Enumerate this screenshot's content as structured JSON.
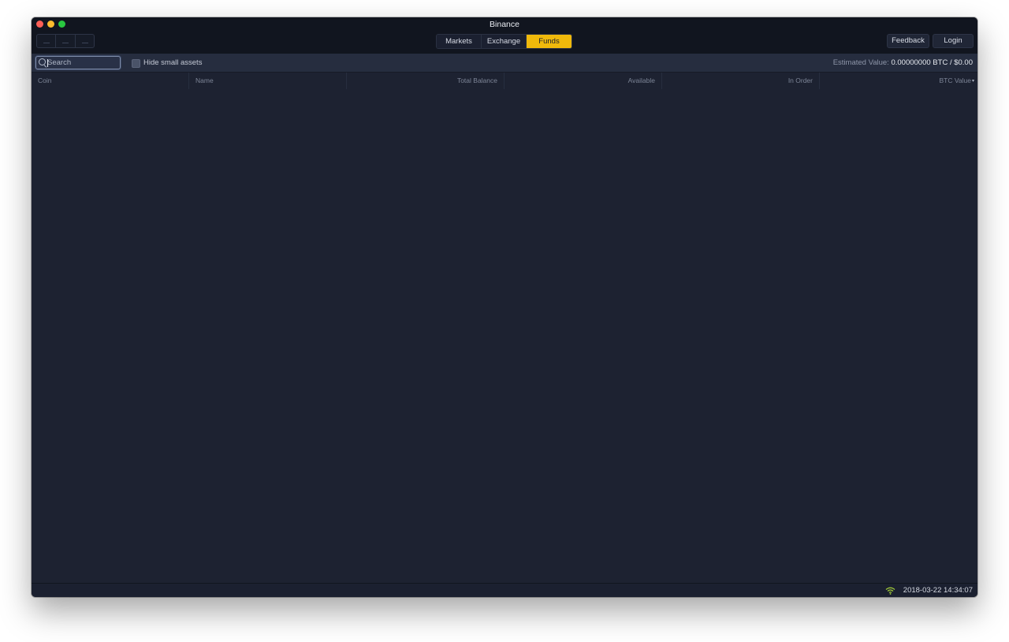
{
  "window": {
    "title": "Binance"
  },
  "tabs": [
    {
      "label": "Markets"
    },
    {
      "label": "Exchange"
    },
    {
      "label": "Funds",
      "active": true
    }
  ],
  "toolbar": {
    "feedback_label": "Feedback",
    "login_label": "Login"
  },
  "filter": {
    "search_placeholder": "Search",
    "search_value": "",
    "hide_small_assets_label": "Hide small assets",
    "hide_small_assets_checked": false,
    "estimated_label": "Estimated Value:",
    "estimated_value": "0.00000000 BTC / $0.00"
  },
  "table": {
    "columns": [
      "Coin",
      "Name",
      "Total Balance",
      "Available",
      "In Order",
      "BTC Value"
    ],
    "sort_indicator": "▾",
    "rows": []
  },
  "status": {
    "connection_icon": "wifi-icon",
    "timestamp": "2018-03-22 14:34:07"
  },
  "colors": {
    "accent": "#f0b90b",
    "background": "#1d2231",
    "connection_ok": "#a6d13a"
  }
}
